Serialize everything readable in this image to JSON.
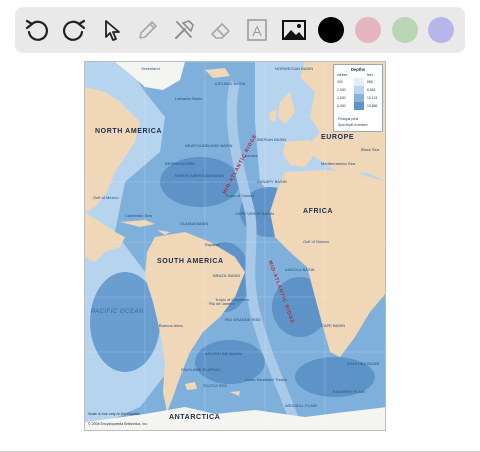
{
  "toolbar": {
    "tools": [
      {
        "name": "undo-icon",
        "interactable": true
      },
      {
        "name": "redo-icon",
        "interactable": true
      },
      {
        "name": "pointer-icon",
        "interactable": true
      },
      {
        "name": "pencil-icon",
        "interactable": true
      },
      {
        "name": "tools-icon",
        "interactable": true
      },
      {
        "name": "eraser-icon",
        "interactable": true
      },
      {
        "name": "text-icon",
        "interactable": true
      },
      {
        "name": "image-icon",
        "interactable": true
      }
    ],
    "text_tool_glyph": "A",
    "colors": [
      "#000000",
      "#e6b6c0",
      "#b9d6b4",
      "#b7b6ea"
    ]
  },
  "map": {
    "continents": {
      "north_america": "NORTH AMERICA",
      "europe": "EUROPE",
      "africa": "AFRICA",
      "south_america": "SOUTH AMERICA",
      "antarctica": "ANTARCTICA"
    },
    "ridges": {
      "mid_atlantic_north": "MID-ATLANTIC RIDGE",
      "mid_atlantic_south": "MID-ATLANTIC RIDGE"
    },
    "oceans": {
      "pacific": "PACIFIC OCEAN"
    },
    "features": {
      "greenland": "Greenland",
      "iceland_basin": "ICELAND BASIN",
      "norwegian_basin": "NORWEGIAN BASIN",
      "labrador_basin": "Labrador Basin",
      "newfoundland_basin": "NEWFOUNDLAND BASIN",
      "north_american_basin": "NORTH AMERICAN BASIN",
      "bermuda_rise": "BERMUDA RISE",
      "azores": "Azores",
      "iberian_basin": "IBERIAN BASIN",
      "canary_basin": "CANARY BASIN",
      "tropic_cancer": "Tropic of Cancer",
      "cape_verde_basin": "CAPE VERDE BASIN",
      "guiana_basin": "GUIANA BASIN",
      "gulf_guinea": "Gulf of Guinea",
      "equator": "Equator",
      "brazil_basin": "BRAZIL BASIN",
      "angola_basin": "ANGOLA BASIN",
      "tropic_capricorn": "Tropic of Capricorn",
      "rio_grande_rise": "RIO GRANDE RISE",
      "argentine_basin": "ARGENTINE BASIN",
      "cape_basin": "CAPE BASIN",
      "agulhas_basin": "AGULHAS BASIN",
      "falkland_plateau": "FALKLAND PLATEAU",
      "scotia_sea": "SCOTIA SEA",
      "weddell_plain": "WEDDELL PLAIN",
      "enderby_plain": "ENDERBY PLAIN",
      "south_sandwich": "South Sandwich Trench",
      "caribbean_sea": "Caribbean Sea",
      "gulf_mexico": "Gulf of Mexico",
      "mediterranean": "Mediterranean Sea",
      "black_sea": "Black Sea",
      "buenos_aires": "Buenos Aires",
      "rio": "Rio de Janeiro"
    },
    "legend": {
      "title": "Depths",
      "metres_label": "metres",
      "feet_label": "feet",
      "metres": [
        "200",
        "2,000",
        "4,000",
        "6,000"
      ],
      "feet": [
        "656",
        "6,562",
        "13,124",
        "19,686"
      ],
      "bands": [
        "#e3eef8",
        "#bcd6ee",
        "#86b3dd",
        "#5c93c9"
      ],
      "note1": "Principal ports",
      "note2": "Spot depth in metres"
    },
    "footer": {
      "scale": "Scale is true only on the Equator",
      "copyright": "© 2008 Encyclopædia Britannica, Inc."
    }
  }
}
